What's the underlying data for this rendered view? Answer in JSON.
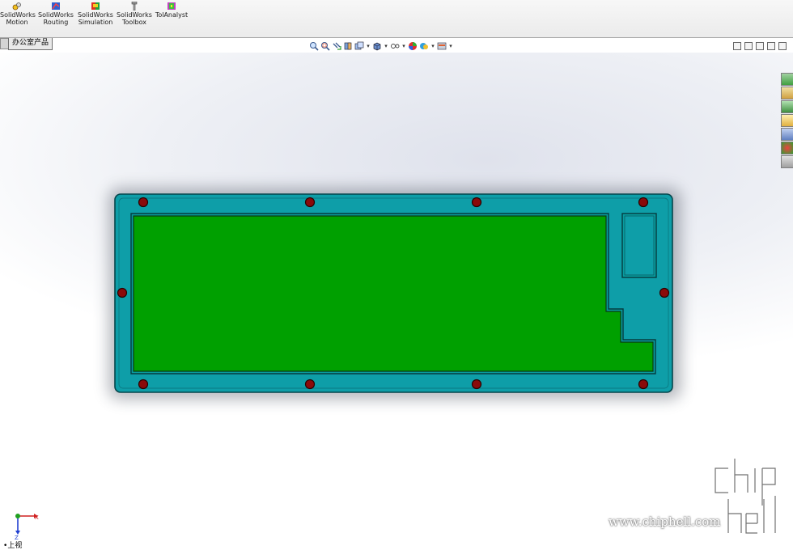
{
  "ribbon": {
    "buttons": [
      {
        "line1": "SolidWorks",
        "line2": "Motion",
        "icon": "motion-icon"
      },
      {
        "line1": "SolidWorks",
        "line2": "Routing",
        "icon": "routing-icon"
      },
      {
        "line1": "SolidWorks",
        "line2": "Simulation",
        "icon": "simulation-icon"
      },
      {
        "line1": "SolidWorks",
        "line2": "Toolbox",
        "icon": "toolbox-icon"
      },
      {
        "line1": "TolAnalyst",
        "line2": "",
        "icon": "tolanalyst-icon"
      }
    ]
  },
  "tabs": {
    "active": "办公室产品"
  },
  "view": {
    "label": "上视",
    "axis_x": "X",
    "axis_z": "Z"
  },
  "watermark": {
    "text": "www.chiphell.com",
    "logo": "chiphell-logo"
  },
  "colors": {
    "frame": "#0e9ea8",
    "panel": "#00a000",
    "screw": "#8a0a0a"
  }
}
